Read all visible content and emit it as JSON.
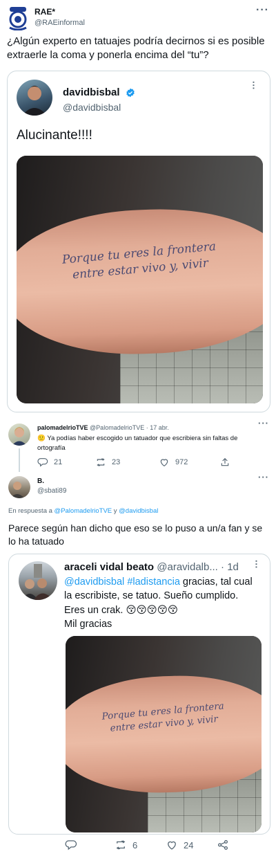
{
  "rae": {
    "name": "RAE*",
    "handle": "@RAEinformal",
    "text": "¿Algún experto en tatuajes podría decirnos si es posible extraerle la coma y ponerla encima del “tu”?"
  },
  "quoted": {
    "name": "davidbisbal",
    "handle": "@davidbisbal",
    "text": "Alucinante!!!!",
    "tattoo_line1": "Porque tu eres la frontera",
    "tattoo_line2": "entre estar vivo y, vivir"
  },
  "reply1": {
    "name": "palomadelrioTVE",
    "handle": "@PalomadelrioTVE",
    "date": "· 17 abr.",
    "emoji": "🙂",
    "text": "Ya podías haber escogido un tatuador que escribiera sin faltas de ortografía",
    "replies": "21",
    "retweets": "23",
    "likes": "972"
  },
  "reply2": {
    "name": "B.",
    "handle": "@sbati89",
    "in_reply_prefix": "En respuesta a ",
    "in_reply_user1": "@PalomadelrioTVE",
    "in_reply_and": " y ",
    "in_reply_user2": "@davidbisbal",
    "text": "Parece según han dicho que eso se lo puso a un/a fan y se lo ha tatuado"
  },
  "quoted2": {
    "name": "araceli vidal beato",
    "handle": "@aravidalb...",
    "date": "· 1d",
    "mention1": "@davidbisbal",
    "hashtag": "#ladistancia",
    "text1": " gracias, tal cual la escribiste, se tatuo. Sueño cumplido. Eres un crak. ",
    "emojis": "😚😚😚😚😚",
    "text2": "Mil gracias",
    "retweets": "6",
    "likes": "24"
  },
  "colors": {
    "accent": "#1d9bf0",
    "muted": "#536471",
    "border": "#cfd9de"
  }
}
